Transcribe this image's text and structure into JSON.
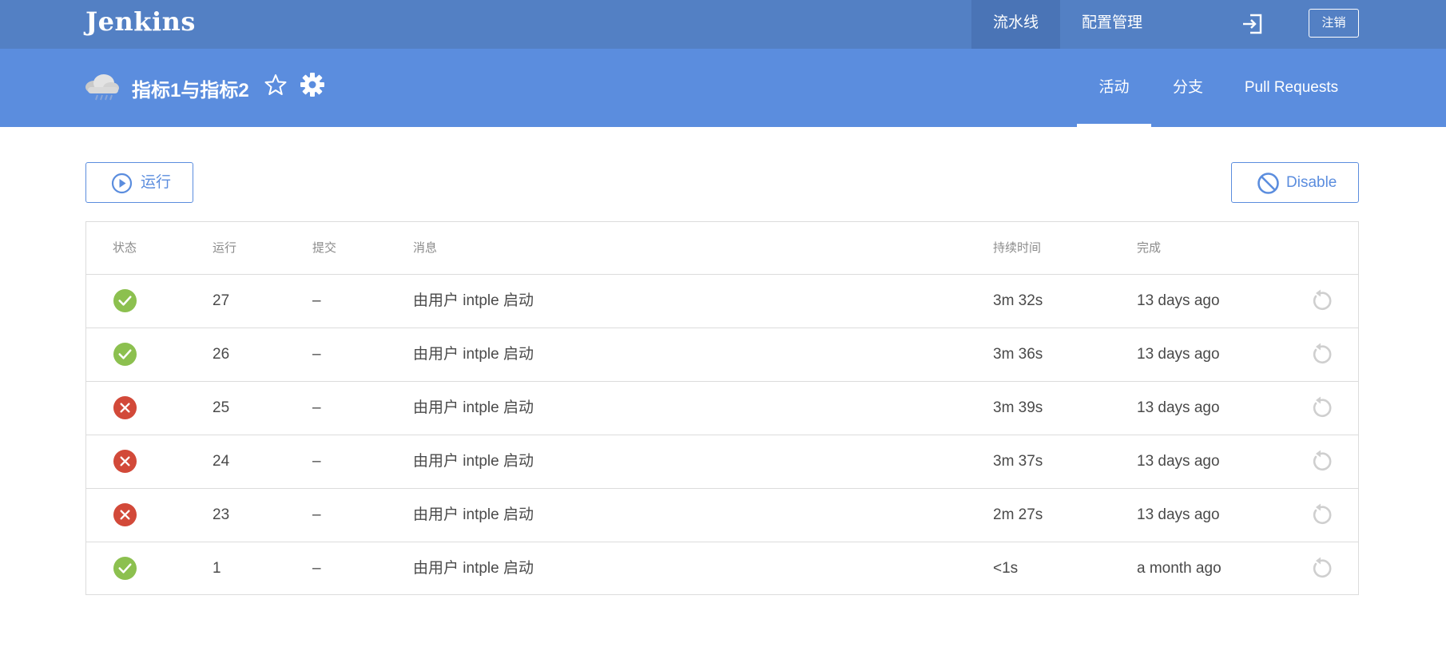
{
  "topbar": {
    "logo": "Jenkins",
    "nav": [
      {
        "label": "流水线",
        "active": true
      },
      {
        "label": "配置管理",
        "active": false
      }
    ],
    "exit_icon": "sign-out-icon",
    "logout_label": "注销"
  },
  "pipeline": {
    "weather_icon": "rain-cloud-icon",
    "title": "指标1与指标2",
    "favorite_icon": "star-outline-icon",
    "settings_icon": "gear-icon",
    "tabs": [
      {
        "label": "活动",
        "active": true
      },
      {
        "label": "分支",
        "active": false
      },
      {
        "label": "Pull Requests",
        "active": false
      }
    ]
  },
  "actions": {
    "run_label": "运行",
    "run_icon": "play-circle-icon",
    "disable_label": "Disable",
    "disable_icon": "ban-icon"
  },
  "table": {
    "headers": {
      "status": "状态",
      "run": "运行",
      "commit": "提交",
      "message": "消息",
      "duration": "持续时间",
      "completed": "完成"
    },
    "rows": [
      {
        "status": "success",
        "run": "27",
        "commit": "–",
        "message": "由用户 intple 启动",
        "duration": "3m 32s",
        "completed": "13 days ago"
      },
      {
        "status": "success",
        "run": "26",
        "commit": "–",
        "message": "由用户 intple 启动",
        "duration": "3m 36s",
        "completed": "13 days ago"
      },
      {
        "status": "failure",
        "run": "25",
        "commit": "–",
        "message": "由用户 intple 启动",
        "duration": "3m 39s",
        "completed": "13 days ago"
      },
      {
        "status": "failure",
        "run": "24",
        "commit": "–",
        "message": "由用户 intple 启动",
        "duration": "3m 37s",
        "completed": "13 days ago"
      },
      {
        "status": "failure",
        "run": "23",
        "commit": "–",
        "message": "由用户 intple 启动",
        "duration": "2m 27s",
        "completed": "13 days ago"
      },
      {
        "status": "success",
        "run": "1",
        "commit": "–",
        "message": "由用户 intple 启动",
        "duration": "<1s",
        "completed": "a month ago"
      }
    ]
  },
  "colors": {
    "topbar": "#5380c4",
    "topbar_active": "#4a74b6",
    "header": "#5b8dde",
    "success": "#8cc04f",
    "failure": "#d24939",
    "accent": "#5b8dde"
  }
}
